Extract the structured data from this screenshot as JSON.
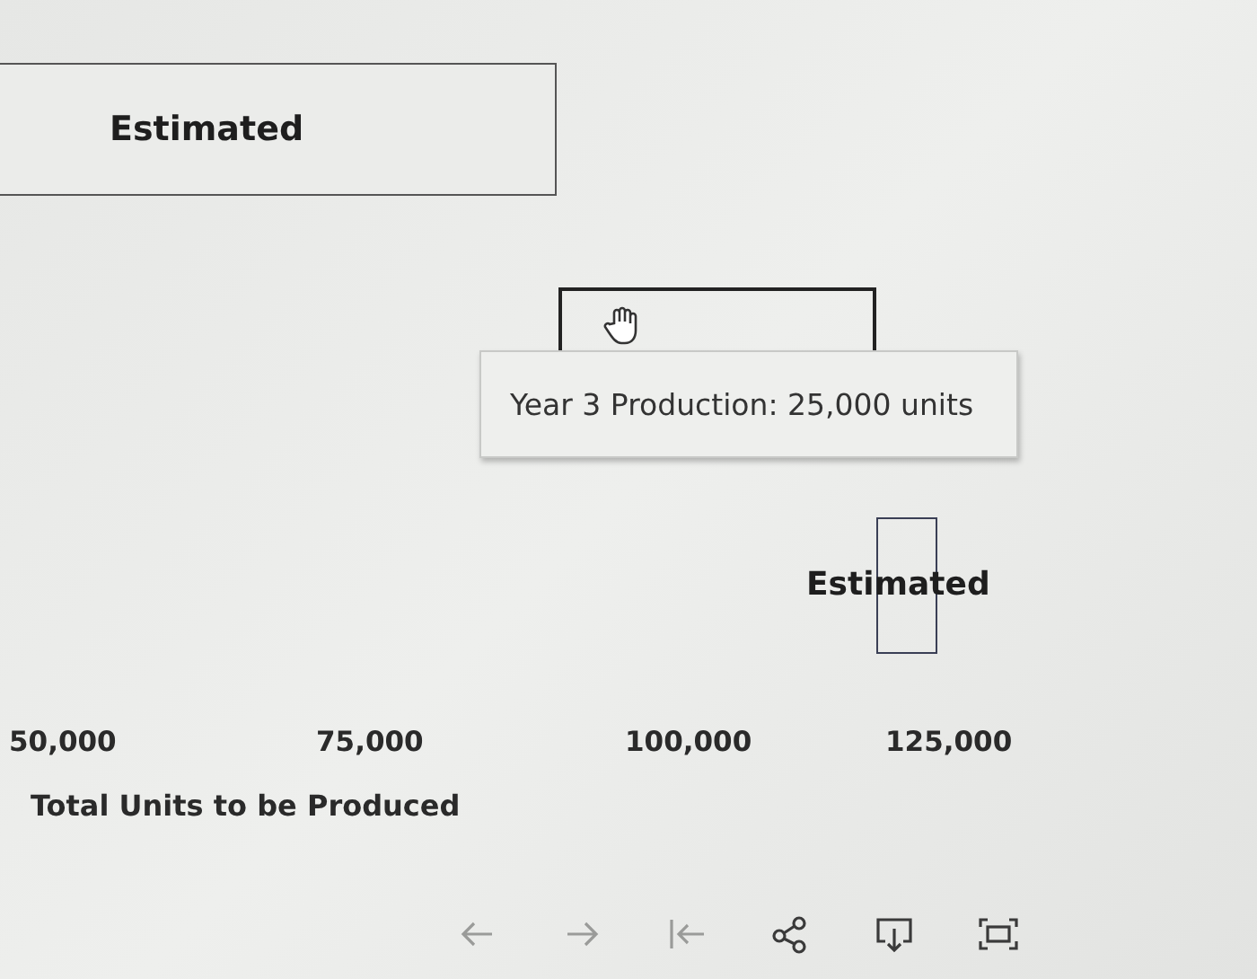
{
  "legend": {
    "label": "Estimated"
  },
  "tooltip": {
    "text": "Year 3 Production: 25,000 units"
  },
  "mark": {
    "label": "Estimated"
  },
  "x_axis": {
    "ticks": [
      "50,000",
      "75,000",
      "100,000",
      "125,000"
    ],
    "title": "Total Units to be Produced"
  },
  "toolbar": [
    {
      "kind": "undo",
      "disabled": true
    },
    {
      "kind": "redo",
      "disabled": true
    },
    {
      "kind": "revert",
      "disabled": true
    },
    {
      "kind": "share",
      "disabled": false
    },
    {
      "kind": "download",
      "disabled": false
    },
    {
      "kind": "fullscreen",
      "disabled": false
    }
  ]
}
